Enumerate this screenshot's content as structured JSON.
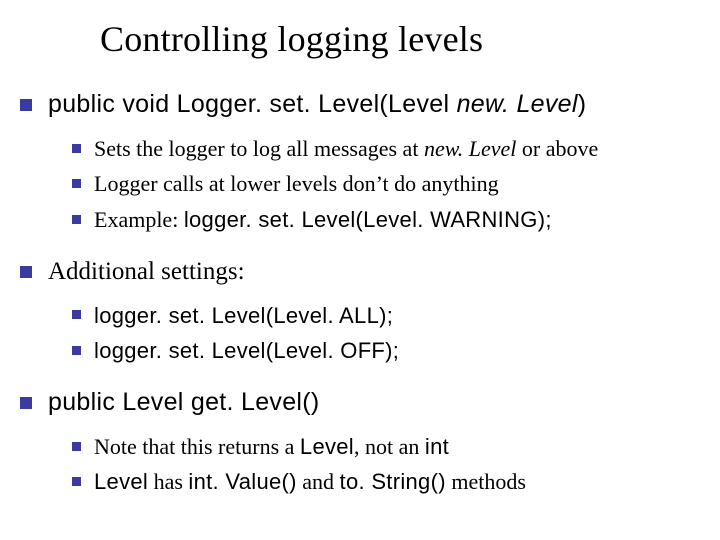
{
  "title": "Controlling logging levels",
  "sections": [
    {
      "heading_html": "<span class='sans'>public void Logger. set. Level(Level </span><span class='sans ital'>new. Level</span><span class='sans'>)</span>",
      "items": [
        "Sets the logger to log all messages at <span class='ital'>new. Level</span> or above",
        "Logger calls at lower levels don’t do anything",
        "Example: <span class='sans'>logger. set. Level(Level. WARNING);</span>"
      ]
    },
    {
      "heading_html": "Additional settings:",
      "items": [
        "<span class='sans'>logger. set. Level(Level. ALL);</span>",
        "<span class='sans'>logger. set. Level(Level. OFF);</span>"
      ]
    },
    {
      "heading_html": "<span class='sans'>public Level get. Level()</span>",
      "items": [
        "Note that this returns a <span class='sans'>Level</span>, not an <span class='sans'>int</span>",
        "<span class='sans'>Level</span> has <span class='sans'>int. Value()</span> and <span class='sans'>to. String()</span> methods"
      ]
    }
  ]
}
